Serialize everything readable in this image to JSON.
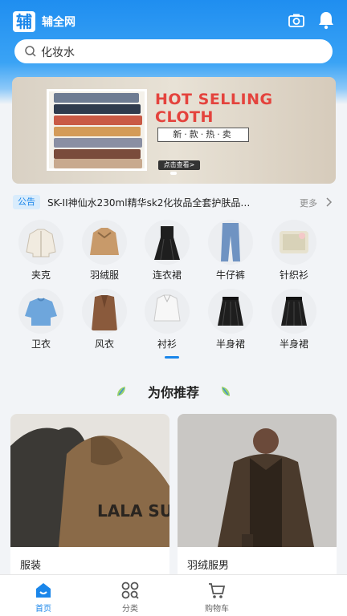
{
  "header": {
    "logo_char": "辅",
    "app_title": "辅全网"
  },
  "search": {
    "query": "化妆水"
  },
  "banner": {
    "headline_line1": "HOT SELLING",
    "headline_line2": "CLOTH",
    "subtitle": "新·款·热·卖",
    "button": "点击查看>"
  },
  "notice": {
    "tag": "公告",
    "text": "SK-II神仙水230ml精华sk2化妆品全套护肤品…",
    "more": "更多"
  },
  "categories": [
    {
      "label": "夹克",
      "icon": "jacket"
    },
    {
      "label": "羽绒服",
      "icon": "down-coat"
    },
    {
      "label": "连衣裙",
      "icon": "dress"
    },
    {
      "label": "牛仔裤",
      "icon": "jeans"
    },
    {
      "label": "针织衫",
      "icon": "knitwear"
    },
    {
      "label": "卫衣",
      "icon": "sweatshirt"
    },
    {
      "label": "风衣",
      "icon": "trench-coat"
    },
    {
      "label": "衬衫",
      "icon": "shirt"
    },
    {
      "label": "半身裙",
      "icon": "skirt"
    },
    {
      "label": "半身裙",
      "icon": "skirt"
    }
  ],
  "recommend": {
    "title": "为你推荐"
  },
  "products": [
    {
      "label": "服装",
      "image_text": "LALA SUSU"
    },
    {
      "label": "羽绒服男"
    }
  ],
  "tabbar": [
    {
      "label": "首页",
      "icon": "home",
      "active": true
    },
    {
      "label": "分类",
      "icon": "grid"
    },
    {
      "label": "购物车",
      "icon": "cart"
    }
  ],
  "colors": {
    "primary": "#1a86ea",
    "banner_red": "#e4433d"
  }
}
